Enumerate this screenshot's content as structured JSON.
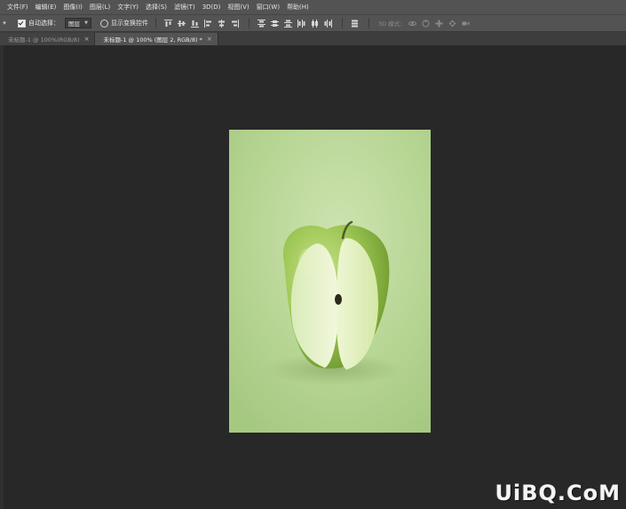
{
  "menu": {
    "items": [
      "文件(F)",
      "编辑(E)",
      "图像(I)",
      "图层(L)",
      "文字(Y)",
      "选择(S)",
      "滤镜(T)",
      "3D(D)",
      "视图(V)",
      "窗口(W)",
      "帮助(H)"
    ]
  },
  "options": {
    "auto_select_label": "自动选择：",
    "auto_select_checked": true,
    "auto_select_target": "图层",
    "show_transform_label": "显示变换控件",
    "mode3d_label": "3D 模式："
  },
  "tabs": [
    {
      "title": "未标题-1 @ 100%(RGB/8)",
      "active": false
    },
    {
      "title": "未标题-1 @ 100% (图层 2, RGB/8) *",
      "active": true
    }
  ],
  "icons": {
    "tool_arrow": "move-tool-chevron-icon",
    "tab_close": "close-icon"
  },
  "colors": {
    "canvas_bg": "#b8d695",
    "workspace_bg": "#282828",
    "chrome_bg": "#535353"
  },
  "watermark": "UiBQ.CoM"
}
